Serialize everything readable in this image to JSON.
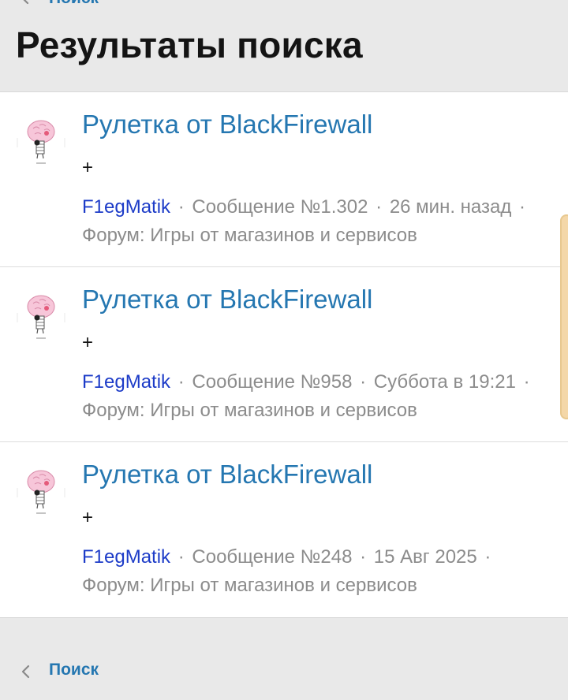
{
  "breadcrumb": {
    "label": "Поиск"
  },
  "page": {
    "title": "Результаты поиска"
  },
  "results": [
    {
      "title": "Рулетка от BlackFirewall",
      "snippet": "+",
      "author": "F1egMatik",
      "post": "Сообщение №1.302",
      "time": "26 мин. назад",
      "forum": "Форум: Игры от магазинов и сервисов"
    },
    {
      "title": "Рулетка от BlackFirewall",
      "snippet": "+",
      "author": "F1egMatik",
      "post": "Сообщение №958",
      "time": "Суббота в 19:21",
      "forum": "Форум: Игры от магазинов и сервисов"
    },
    {
      "title": "Рулетка от BlackFirewall",
      "snippet": "+",
      "author": "F1egMatik",
      "post": "Сообщение №248",
      "time": "15 Авг 2025",
      "forum": "Форум: Игры от магазинов и сервисов"
    }
  ],
  "meta_separator": "·",
  "icons": {
    "back": "chevron-left-icon",
    "avatar": "brain-character-avatar"
  },
  "colors": {
    "link": "#2577b1",
    "author": "#1d3cc8",
    "meta": "#8c8c8c",
    "background": "#e9e9e9",
    "card": "#ffffff",
    "scroll_thumb": "#f4d7a8"
  }
}
